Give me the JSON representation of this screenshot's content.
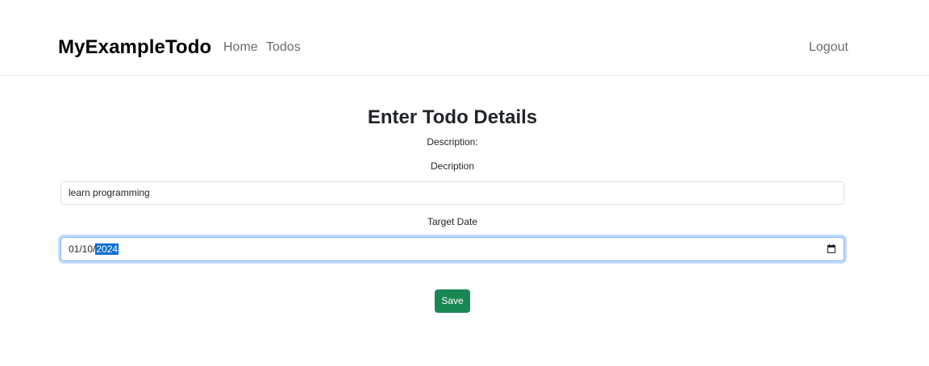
{
  "navbar": {
    "brand": "MyExampleTodo",
    "links": [
      "Home",
      "Todos"
    ],
    "logout": "Logout"
  },
  "form": {
    "title": "Enter Todo Details",
    "description_heading": "Description:",
    "description_label": "Decription",
    "description_value": "learn programming",
    "target_date_label": "Target Date",
    "target_date_prefix": "01/10/",
    "target_date_year": "2024",
    "save_label": "Save"
  },
  "colors": {
    "save_button": "#198754",
    "focus_border": "#86b7fe",
    "selection": "#0a6ed1"
  }
}
